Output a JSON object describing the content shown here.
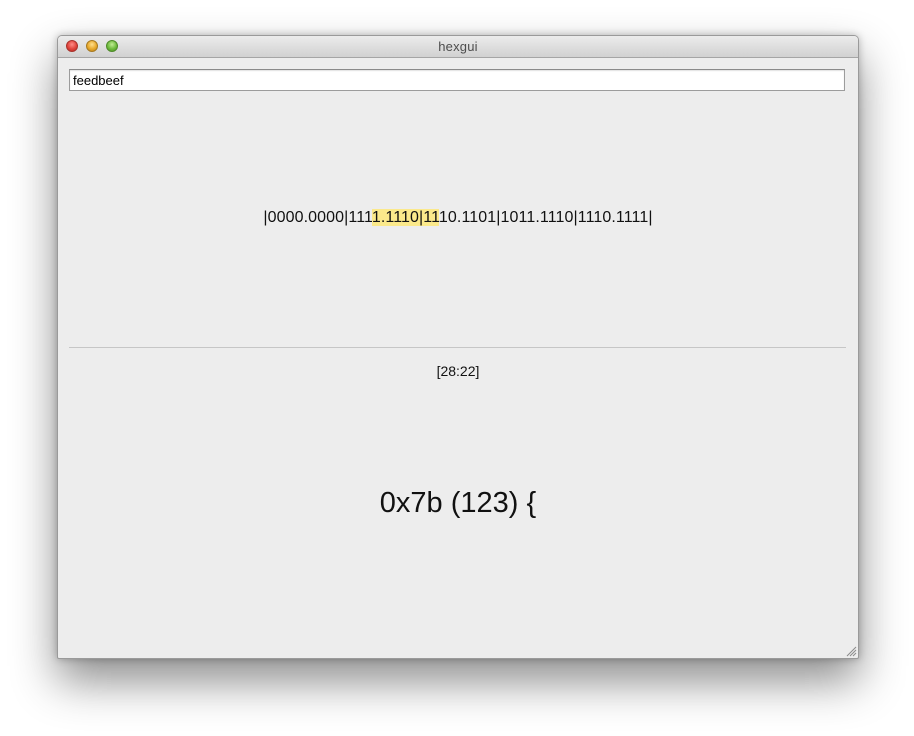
{
  "window": {
    "title": "hexgui"
  },
  "input": {
    "value": "feedbeef"
  },
  "bit_display": {
    "segments": [
      {
        "text": "|0000.0000|111",
        "highlighted": false
      },
      {
        "text": "1.1110|11",
        "highlighted": true
      },
      {
        "text": "10.1101|1011.1110|1110.1111|",
        "highlighted": false
      }
    ],
    "highlight_color": "#fbe98b"
  },
  "selection": {
    "range": "[28:22]"
  },
  "result": {
    "text": "0x7b (123) {"
  },
  "icons": {
    "close": "close-icon",
    "minimize": "minimize-icon",
    "zoom": "zoom-icon",
    "resize": "resize-grip-icon"
  }
}
